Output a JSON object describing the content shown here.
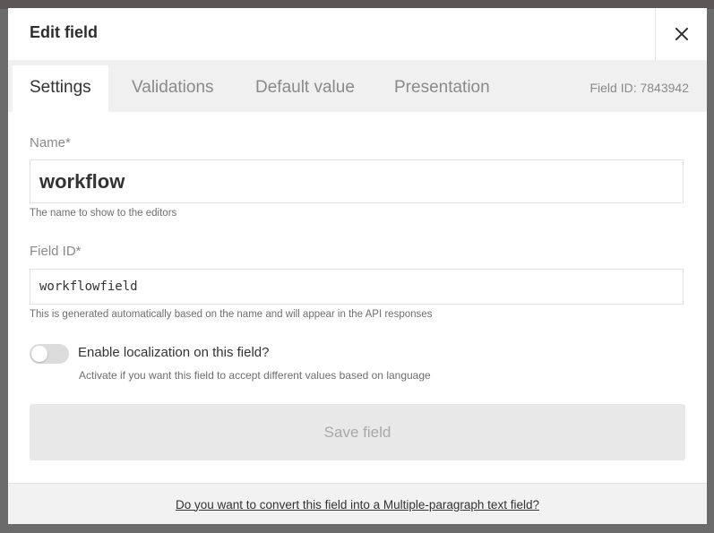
{
  "modal": {
    "title": "Edit field",
    "close_icon": "close-icon"
  },
  "tabs": [
    {
      "label": "Settings",
      "active": true
    },
    {
      "label": "Validations",
      "active": false
    },
    {
      "label": "Default value",
      "active": false
    },
    {
      "label": "Presentation",
      "active": false
    }
  ],
  "field_id_label": "Field ID: 7843942",
  "form": {
    "name": {
      "label": "Name*",
      "value": "workflow",
      "hint": "The name to show to the editors"
    },
    "field_id": {
      "label": "Field ID*",
      "value": "workflowfield",
      "hint": "This is generated automatically based on the name and will appear in the API responses"
    },
    "localization": {
      "label": "Enable localization on this field?",
      "hint": "Activate if you want this field to accept different values based on language",
      "enabled": false
    },
    "save_label": "Save field"
  },
  "footer": {
    "convert_link": "Do you want to convert this field into a Multiple-paragraph text field?"
  },
  "colors": {
    "backdrop": "#6b6b6b",
    "tabbar": "#f0f0f0",
    "save_disabled_bg": "#e8e8e8"
  }
}
